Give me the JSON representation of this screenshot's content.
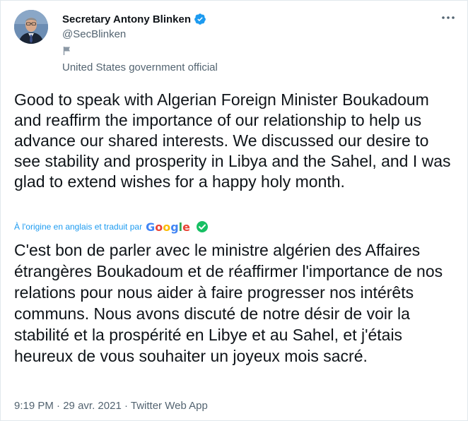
{
  "author": {
    "name": "Secretary Antony Blinken",
    "handle": "@SecBlinken",
    "label": "United States government official",
    "avatar_icon": "profile-photo",
    "verified_icon": "verified-badge-icon",
    "flag_icon": "flag-icon"
  },
  "menu_icon": "more-options-icon",
  "tweet": {
    "text": "Good to speak with Algerian Foreign Minister Boukadoum and reaffirm the importance of our relationship to help us advance our shared interests. We discussed our desire to see stability and prosperity in Libya and the Sahel, and I was glad to extend wishes for a happy holy month."
  },
  "translation": {
    "note": "À l'origine en anglais et traduit par",
    "provider": "Google",
    "text": "C'est bon de parler avec le ministre algérien des Affaires étrangères Boukadoum et de réaffirmer l'importance de nos relations pour nous aider à faire progresser nos intérêts communs. Nous avons discuté de notre désir de voir la stabilité et la prospérité en Libye et au Sahel, et j'étais heureux de vous souhaiter un joyeux mois sacré."
  },
  "meta": {
    "time": "9:19 PM",
    "separator": "·",
    "date": "29 avr. 2021",
    "app": "Twitter Web App"
  },
  "colors": {
    "accent": "#1d9bf0",
    "secondary_text": "#536471",
    "primary_text": "#0f1419",
    "check_green": "#17bf63"
  }
}
